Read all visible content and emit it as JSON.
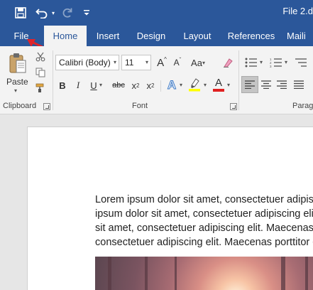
{
  "window": {
    "title": "File 2.d"
  },
  "qat": {
    "save_icon": "save-icon",
    "undo_icon": "undo-icon",
    "redo_icon": "redo-icon",
    "customize_icon": "customize-qat-icon"
  },
  "tabs": [
    {
      "label": "File"
    },
    {
      "label": "Home"
    },
    {
      "label": "Insert"
    },
    {
      "label": "Design"
    },
    {
      "label": "Layout"
    },
    {
      "label": "References"
    },
    {
      "label": "Maili"
    }
  ],
  "active_tab": "Home",
  "ribbon": {
    "clipboard": {
      "group_label": "Clipboard",
      "paste_label": "Paste"
    },
    "font": {
      "group_label": "Font",
      "font_name": "Calibri (Body)",
      "font_size": "11",
      "bold": "B",
      "italic": "I",
      "underline": "U",
      "strikethrough": "abc",
      "subscript": "x",
      "superscript": "x",
      "grow": "A",
      "shrink": "A",
      "text_effects": "A",
      "font_color": "A",
      "highlight_color": "#ffff00",
      "font_color_value": "#e02020"
    },
    "paragraph": {
      "group_label": "Parag"
    }
  },
  "colors": {
    "brand": "#2b579a",
    "ribbon_bg": "#f3f3f3",
    "annotation_arrow": "#e0242a"
  },
  "document": {
    "paragraph_lines": [
      "Lorem ipsum dolor sit amet, consectetuer adipiscing",
      "ipsum dolor sit amet, consectetuer adipiscing elit. M",
      "sit amet, consectetuer adipiscing elit. Maecenas po",
      "consectetuer adipiscing elit. Maecenas porttitor co"
    ]
  }
}
